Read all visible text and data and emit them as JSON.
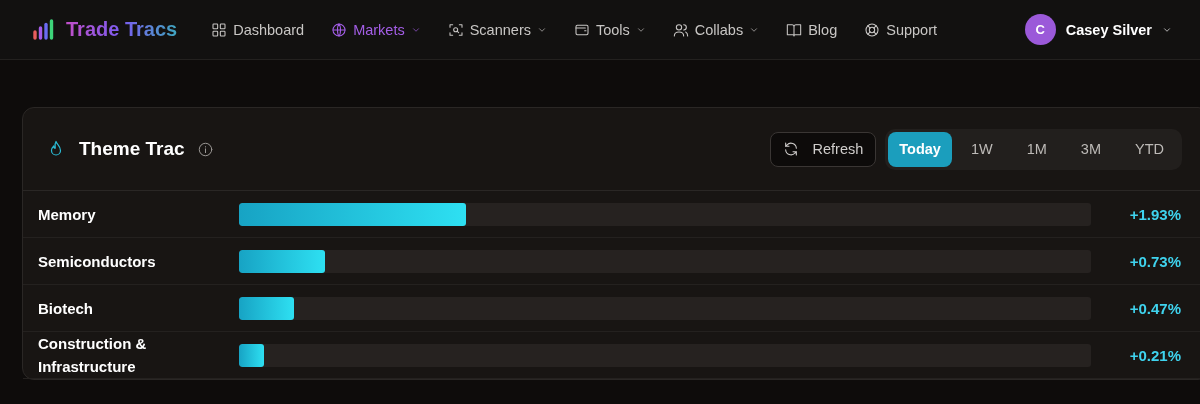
{
  "brand": {
    "name": "Trade Tracs"
  },
  "nav": [
    {
      "label": "Dashboard",
      "selected": false,
      "has_menu": false
    },
    {
      "label": "Markets",
      "selected": true,
      "has_menu": true
    },
    {
      "label": "Scanners",
      "selected": false,
      "has_menu": true
    },
    {
      "label": "Tools",
      "selected": false,
      "has_menu": true
    },
    {
      "label": "Collabs",
      "selected": false,
      "has_menu": true
    },
    {
      "label": "Blog",
      "selected": false,
      "has_menu": false
    },
    {
      "label": "Support",
      "selected": false,
      "has_menu": false
    }
  ],
  "user": {
    "initial": "C",
    "name": "Casey Silver"
  },
  "card": {
    "title": "Theme Trac",
    "refresh": "Refresh",
    "ranges": [
      {
        "label": "Today",
        "selected": true
      },
      {
        "label": "1W",
        "selected": false
      },
      {
        "label": "1M",
        "selected": false
      },
      {
        "label": "3M",
        "selected": false
      },
      {
        "label": "YTD",
        "selected": false
      }
    ],
    "themes": [
      {
        "name": "Memory",
        "level": 0.267,
        "change": "+1.93%"
      },
      {
        "name": "Semiconductors",
        "level": 0.101,
        "change": "+0.73%"
      },
      {
        "name": "Biotech",
        "level": 0.065,
        "change": "+0.47%"
      },
      {
        "name": "Construction & Infrastructure",
        "level": 0.029,
        "change": "+0.21%"
      }
    ]
  }
}
